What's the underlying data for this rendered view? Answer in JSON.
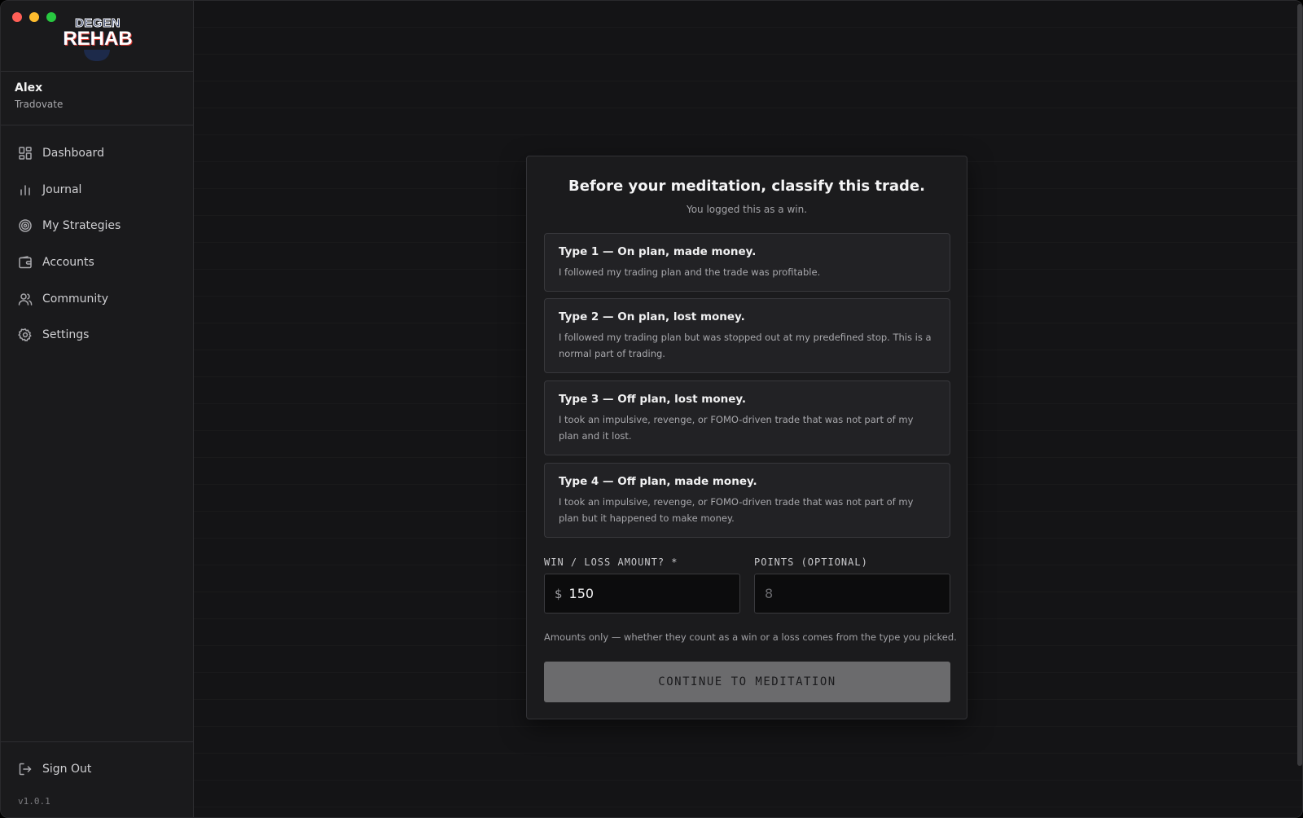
{
  "window": {
    "traffic_lights": [
      "close",
      "minimize",
      "zoom"
    ]
  },
  "logo": {
    "top": "DEGEN",
    "bottom": "REHAB"
  },
  "user": {
    "name": "Alex",
    "broker": "Tradovate"
  },
  "sidebar": {
    "items": [
      {
        "label": "Dashboard",
        "icon": "dashboard-icon"
      },
      {
        "label": "Journal",
        "icon": "bar-chart-icon"
      },
      {
        "label": "My Strategies",
        "icon": "target-icon"
      },
      {
        "label": "Accounts",
        "icon": "wallet-icon"
      },
      {
        "label": "Community",
        "icon": "users-icon"
      },
      {
        "label": "Settings",
        "icon": "gear-icon"
      }
    ],
    "sign_out": "Sign Out",
    "version": "v1.0.1"
  },
  "modal": {
    "title": "Before your meditation, classify this trade.",
    "subtitle": "You logged this as a win.",
    "options": [
      {
        "title": "Type 1 — On plan, made money.",
        "desc": "I followed my trading plan and the trade was profitable."
      },
      {
        "title": "Type 2 — On plan, lost money.",
        "desc": "I followed my trading plan but was stopped out at my predefined stop. This is a normal part of trading."
      },
      {
        "title": "Type 3 — Off plan, lost money.",
        "desc": "I took an impulsive, revenge, or FOMO-driven trade that was not part of my plan and it lost."
      },
      {
        "title": "Type 4 — Off plan, made money.",
        "desc": "I took an impulsive, revenge, or FOMO-driven trade that was not part of my plan but it happened to make money."
      }
    ],
    "amount": {
      "label": "WIN / LOSS AMOUNT? *",
      "currency": "$",
      "value": "150"
    },
    "points": {
      "label": "POINTS (OPTIONAL)",
      "placeholder": "8"
    },
    "hint": "Amounts only — whether they count as a win or a loss comes from the type you picked.",
    "continue_label": "CONTINUE TO MEDITATION"
  }
}
